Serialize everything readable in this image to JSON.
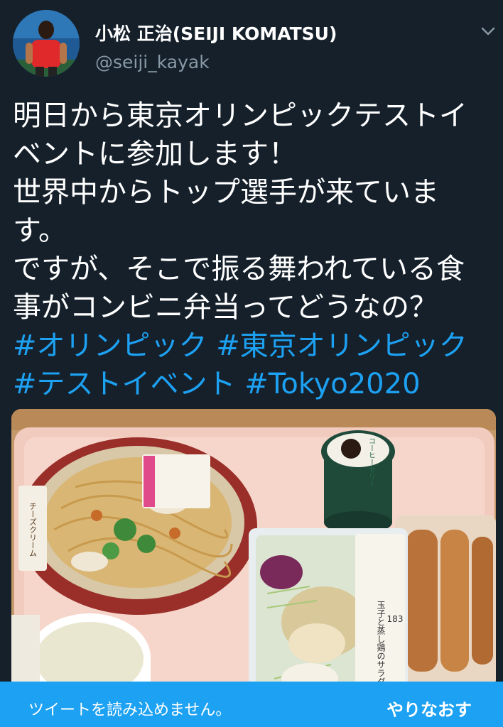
{
  "user": {
    "display_name": "小松 正治(SEIJI KOMATSU)",
    "handle": "@seiji_kayak"
  },
  "tweet": {
    "lines": [
      "明日から東京オリンピックテストイ",
      "ベントに参加します！",
      "世界中からトップ選手が来ていま",
      "す。",
      "ですが、そこで振る舞われている食",
      "事がコンビニ弁当ってどうなの？"
    ],
    "hashtag_lines": [
      "#オリンピック #東京オリンピック",
      "#テストイベント #Tokyo2020"
    ]
  },
  "photo": {
    "coffee_jelly_label": "コーヒーゼリー",
    "pasta_label": "チーズクリーム",
    "salad_label": "玉子と蒸し鶏のサラダ",
    "salad_price": "183"
  },
  "error_bar": {
    "message": "ツイートを読み込めません。",
    "retry_label": "やりなおす",
    "color": "#1da1f2"
  },
  "icons": [
    "avatar",
    "chevron-down-icon"
  ],
  "colors": {
    "background": "#15202b",
    "text": "#ffffff",
    "secondary": "#8899a6",
    "accent": "#1da1f2"
  }
}
